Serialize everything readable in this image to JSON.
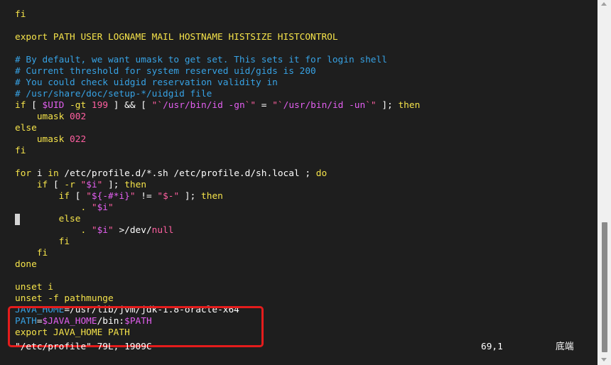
{
  "colors": {
    "background": "#1e1e1e",
    "text": "#ffffff",
    "comment": "#37a2e4",
    "keyword": "#f5e34a",
    "string": "#ff5fa0",
    "variable": "#e35ff0",
    "highlight_border": "#e41c1c"
  },
  "editor": {
    "lines": [
      [
        {
          "t": "fi",
          "c": "keyword"
        }
      ],
      [],
      [
        {
          "t": "export PATH USER LOGNAME MAIL HOSTNAME HISTSIZE HISTCONTROL",
          "c": "keyword"
        }
      ],
      [],
      [
        {
          "t": "# By default, we want umask to get set. This sets it for login shell",
          "c": "comment"
        }
      ],
      [
        {
          "t": "# Current threshold for system reserved uid/gids is 200",
          "c": "comment"
        }
      ],
      [
        {
          "t": "# You could check uidgid reservation validity in",
          "c": "comment"
        }
      ],
      [
        {
          "t": "# /usr/share/doc/setup-*/uidgid file",
          "c": "comment"
        }
      ],
      [
        {
          "t": "if",
          "c": "keyword"
        },
        {
          "t": " [ ",
          "c": "text"
        },
        {
          "t": "$UID",
          "c": "variable"
        },
        {
          "t": " -gt ",
          "c": "keyword"
        },
        {
          "t": "199",
          "c": "string"
        },
        {
          "t": " ] && [ ",
          "c": "text"
        },
        {
          "t": "\"`",
          "c": "string"
        },
        {
          "t": "/usr/bin/id -gn",
          "c": "variable"
        },
        {
          "t": "`\"",
          "c": "string"
        },
        {
          "t": " = ",
          "c": "text"
        },
        {
          "t": "\"`",
          "c": "string"
        },
        {
          "t": "/usr/bin/id -un",
          "c": "variable"
        },
        {
          "t": "`\"",
          "c": "string"
        },
        {
          "t": " ]; ",
          "c": "text"
        },
        {
          "t": "then",
          "c": "keyword"
        }
      ],
      [
        {
          "t": "    umask ",
          "c": "keyword"
        },
        {
          "t": "002",
          "c": "string"
        }
      ],
      [
        {
          "t": "else",
          "c": "keyword"
        }
      ],
      [
        {
          "t": "    umask ",
          "c": "keyword"
        },
        {
          "t": "022",
          "c": "string"
        }
      ],
      [
        {
          "t": "fi",
          "c": "keyword"
        }
      ],
      [],
      [
        {
          "t": "for",
          "c": "keyword"
        },
        {
          "t": " i ",
          "c": "text"
        },
        {
          "t": "in",
          "c": "keyword"
        },
        {
          "t": " /etc/profile.d/*.sh /etc/profile.d/sh.local ; ",
          "c": "text"
        },
        {
          "t": "do",
          "c": "keyword"
        }
      ],
      [
        {
          "t": "    ",
          "c": "text"
        },
        {
          "t": "if",
          "c": "keyword"
        },
        {
          "t": " [ ",
          "c": "text"
        },
        {
          "t": "-r",
          "c": "keyword"
        },
        {
          "t": " ",
          "c": "text"
        },
        {
          "t": "\"",
          "c": "string"
        },
        {
          "t": "$i",
          "c": "variable"
        },
        {
          "t": "\"",
          "c": "string"
        },
        {
          "t": " ]; ",
          "c": "text"
        },
        {
          "t": "then",
          "c": "keyword"
        }
      ],
      [
        {
          "t": "        ",
          "c": "text"
        },
        {
          "t": "if",
          "c": "keyword"
        },
        {
          "t": " [ ",
          "c": "text"
        },
        {
          "t": "\"",
          "c": "string"
        },
        {
          "t": "${-#*i}",
          "c": "variable"
        },
        {
          "t": "\"",
          "c": "string"
        },
        {
          "t": " != ",
          "c": "text"
        },
        {
          "t": "\"$-\"",
          "c": "string"
        },
        {
          "t": " ]; ",
          "c": "text"
        },
        {
          "t": "then",
          "c": "keyword"
        }
      ],
      [
        {
          "t": "            . ",
          "c": "keyword"
        },
        {
          "t": "\"",
          "c": "string"
        },
        {
          "t": "$i",
          "c": "variable"
        },
        {
          "t": "\"",
          "c": "string"
        }
      ],
      [
        {
          "t": "        else",
          "c": "keyword"
        }
      ],
      [
        {
          "t": "            . ",
          "c": "keyword"
        },
        {
          "t": "\"",
          "c": "string"
        },
        {
          "t": "$i",
          "c": "variable"
        },
        {
          "t": "\"",
          "c": "string"
        },
        {
          "t": " >/dev/",
          "c": "text"
        },
        {
          "t": "null",
          "c": "string"
        }
      ],
      [
        {
          "t": "        fi",
          "c": "keyword"
        }
      ],
      [
        {
          "t": "    fi",
          "c": "keyword"
        }
      ],
      [
        {
          "t": "done",
          "c": "keyword"
        }
      ],
      [],
      [
        {
          "t": "unset",
          "c": "keyword"
        },
        {
          "t": " i",
          "c": "keyword"
        }
      ],
      [
        {
          "t": "unset",
          "c": "keyword"
        },
        {
          "t": " -f ",
          "c": "keyword"
        },
        {
          "t": "pathmunge",
          "c": "keyword"
        }
      ],
      [
        {
          "t": "JAVA_HOME",
          "c": "comment"
        },
        {
          "t": "=/usr/lib/jvm/jdk-1.8-oracle-x64",
          "c": "text"
        }
      ],
      [
        {
          "t": "PATH",
          "c": "comment"
        },
        {
          "t": "=",
          "c": "text"
        },
        {
          "t": "$JAVA_HOME",
          "c": "variable"
        },
        {
          "t": "/bin:",
          "c": "text"
        },
        {
          "t": "$PATH",
          "c": "variable"
        }
      ],
      [
        {
          "t": "export JAVA_HOME PATH",
          "c": "keyword"
        }
      ]
    ]
  },
  "status": {
    "file": "\"/etc/profile\" 79L, 1909C",
    "position": "69,1",
    "scroll": "底端"
  }
}
